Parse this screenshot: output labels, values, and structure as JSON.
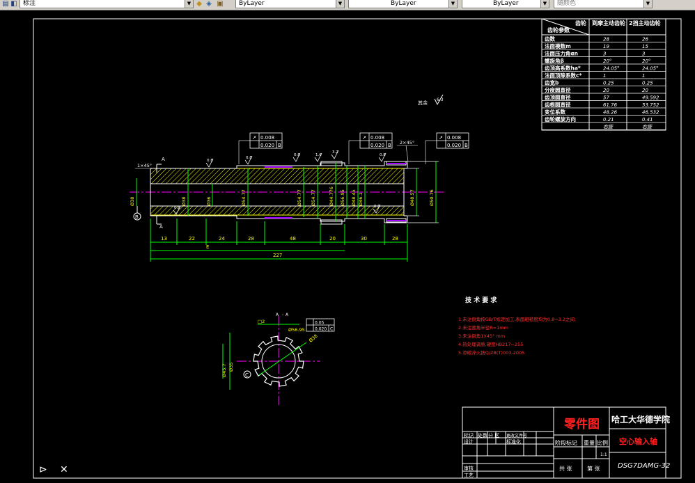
{
  "toolbar": {
    "layer_combo": "标注",
    "color_combo": "ByLayer",
    "linetype_combo": "ByLayer",
    "lineweight_combo": "ByLayer",
    "plotstyle_combo": "随颜色"
  },
  "param_table": {
    "diag_top": "齿轮",
    "diag_bottom": "齿轮参数",
    "col1": "到摩主动齿轮",
    "col2": "2挡主动齿轮",
    "rows": [
      [
        "齿数",
        "28",
        "26"
      ],
      [
        "法面模数m",
        "19",
        "15"
      ],
      [
        "法面压力角αn",
        "3",
        "3"
      ],
      [
        "螺旋角β",
        "20°",
        "20°"
      ],
      [
        "齿顶高系数ha*",
        "24.05°",
        "24.05°"
      ],
      [
        "法面顶隙系数c*",
        "1",
        "1"
      ],
      [
        "齿宽b",
        "0.25",
        "0.25"
      ],
      [
        "分度圆直径",
        "20",
        "20"
      ],
      [
        "齿顶圆直径",
        "57",
        "49.592"
      ],
      [
        "齿根圆直径",
        "61.76",
        "53.752"
      ],
      [
        "变位系数",
        "48.26",
        "46.532"
      ],
      [
        "齿轮螺旋方向",
        "0.21",
        "0.41"
      ],
      [
        "",
        "右旋",
        "右旋"
      ]
    ]
  },
  "title_block": {
    "drawing_type": "零件图",
    "school": "哈工大华德学院",
    "part_name": "空心输入轴",
    "drawing_no": "DSG7DAMG-32",
    "stage_mark": "阶段标记",
    "weight": "重量",
    "scale": "比例",
    "scale_value": "1:1",
    "sheet_total": "共 张",
    "sheet_no": "第 张",
    "mark": "标记",
    "count": "处数",
    "zone": "分 区",
    "change_doc": "更改文件号",
    "designer": "设计",
    "standardize": "标准化",
    "review": "审核",
    "process": "工艺"
  },
  "tech_req": {
    "title": "技 术 要 求",
    "items": [
      "1.未注倒角按GB/T规定加工,表面粗糙度均为0.8~3.2之间;",
      "2.未注圆角半径R=1mm",
      "3.未注倒角1X45° mm",
      "4.热处理调质,硬度HB217~255",
      "5.渗碳淬火按Q/ZB(T)003-2005"
    ]
  },
  "annotations": {
    "roughness_rest": "其余",
    "roughness_rest_value": "6.3",
    "chamfer_left": "1×45°",
    "chamfer_right": "2×45°",
    "section_mark": "A",
    "datum_b": "B",
    "datum_c": "C",
    "tol1_sym": "↗",
    "tol1_v1": "0.008",
    "tol1_v2": "0.020",
    "tol1_ref": "B",
    "tol2_v1": "0.008",
    "tol2_v2": "0.020",
    "tol2_ref": "B",
    "tol3_v1": "0.008",
    "tol3_v2": "0.020",
    "tol3_ref": "B",
    "tol4_v1": "0.05",
    "tol4_v2": "0.020",
    "tol4_ref": "C",
    "ra_0_8": "0.8",
    "ra_1_6": "1.6",
    "ra_3_2": "3.2",
    "axial_dims": [
      "13",
      "22",
      "24",
      "28",
      "48",
      "20",
      "30",
      "28"
    ],
    "dim_e": "E",
    "dim_total": "227",
    "dia_dims": [
      "Ø38",
      "Ø38",
      "Ø36",
      "Ø54.77",
      "Ø54.77",
      "Ø54.77",
      "Ø44.776",
      "Ø56.95",
      "Ø48.45",
      "Ø46.1",
      "Ø48.57",
      "Ø50.76"
    ],
    "sect_dims": [
      "□2",
      "Ø38",
      "Ø45.7",
      "Ø35",
      "Ø56.95"
    ]
  },
  "command_line": {
    "cursor_glyph": "⊳",
    "cross_glyph": "✕"
  }
}
